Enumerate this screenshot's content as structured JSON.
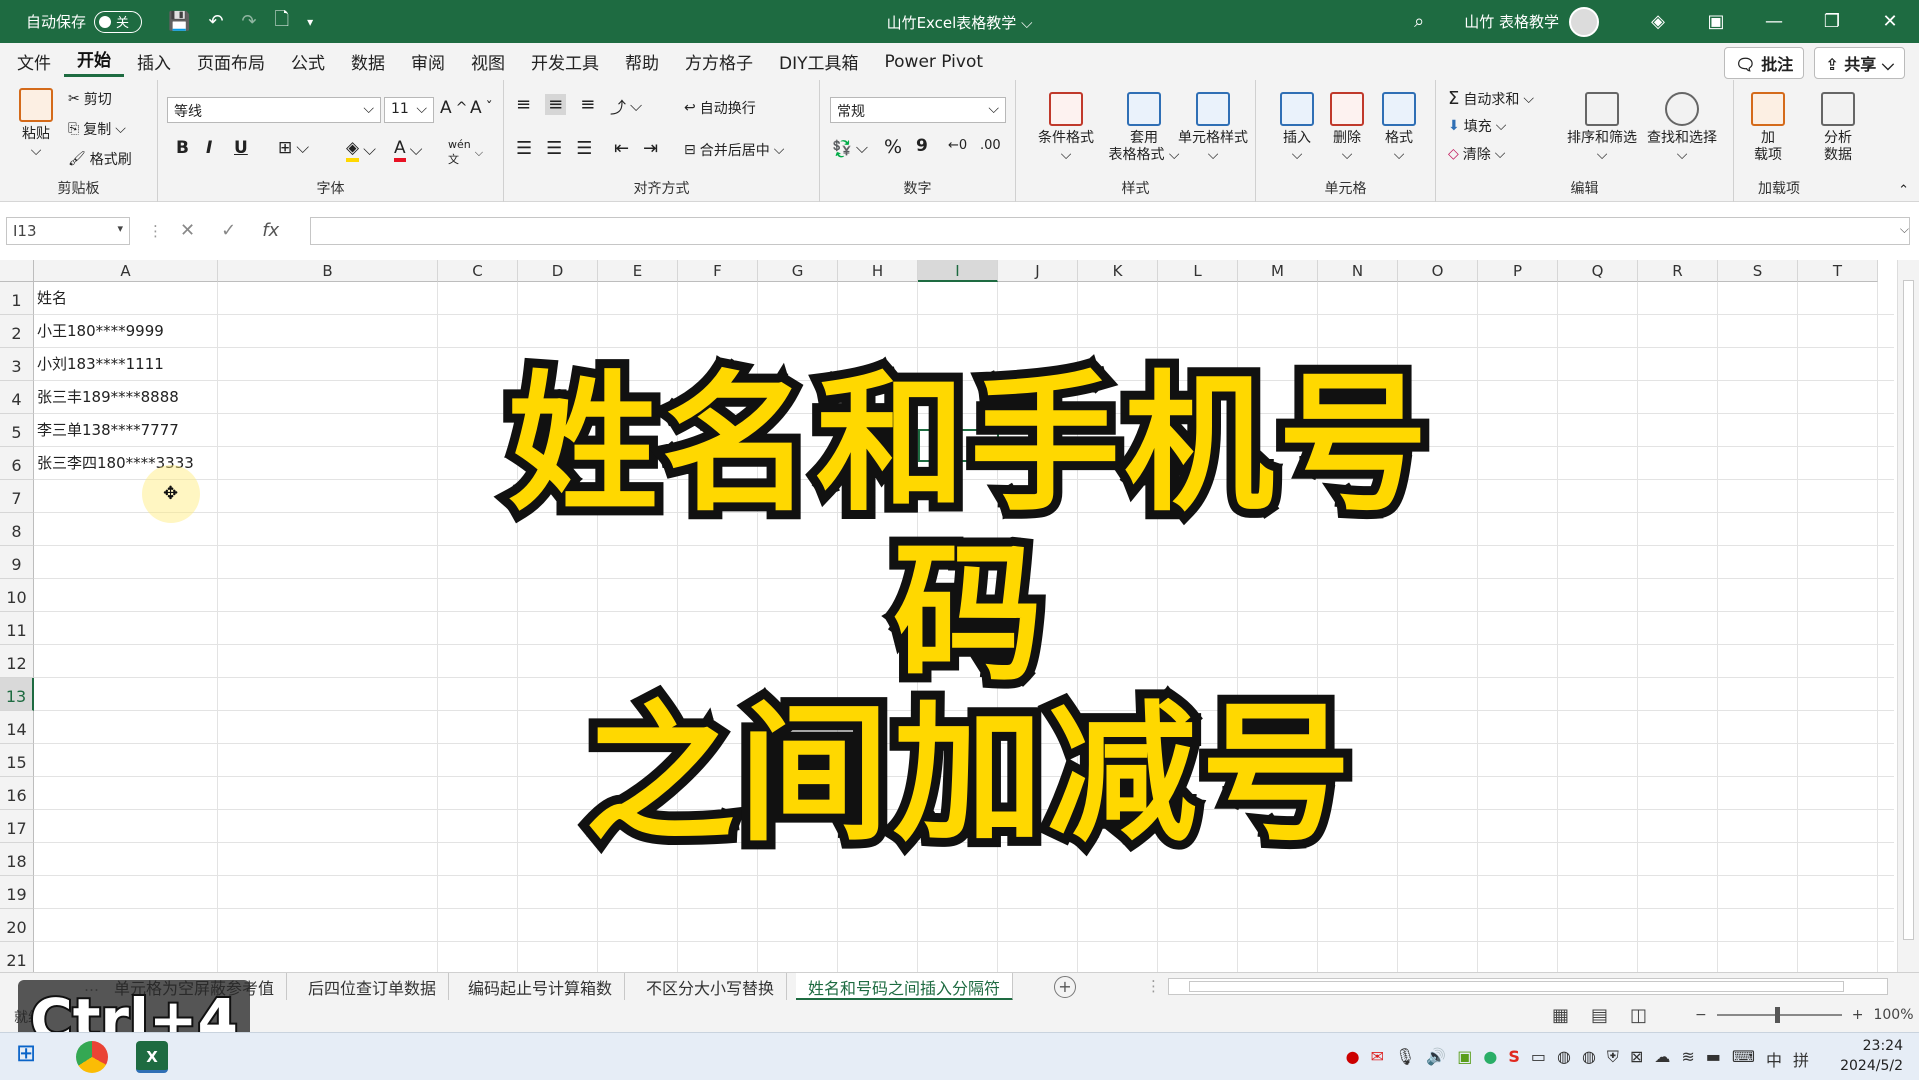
{
  "titlebar": {
    "autosave_label": "自动保存",
    "autosave_state": "关",
    "doc_title": "山竹Excel表格教学 ⌵",
    "user": "山竹 表格教学"
  },
  "menu": {
    "tabs": [
      "文件",
      "开始",
      "插入",
      "页面布局",
      "公式",
      "数据",
      "审阅",
      "视图",
      "开发工具",
      "帮助",
      "方方格子",
      "DIY工具箱",
      "Power Pivot"
    ],
    "comment_btn": "批注",
    "share_btn": "共享"
  },
  "ribbon": {
    "clipboard": {
      "paste": "粘贴",
      "cut": "剪切",
      "copy": "复制",
      "format_painter": "格式刷",
      "label": "剪贴板"
    },
    "font": {
      "name": "等线",
      "size": "11",
      "bold": "B",
      "italic": "I",
      "underline": "U",
      "label": "字体",
      "grow": "A^",
      "shrink": "A˅",
      "phonetic": "wén"
    },
    "alignment": {
      "wrap": "自动换行",
      "merge": "合并后居中",
      "label": "对齐方式"
    },
    "number": {
      "format": "常规",
      "percent": "%",
      "comma": "9",
      "label": "数字"
    },
    "styles": {
      "conditional": "条件格式",
      "table_format": "套用\n表格格式",
      "cell_style": "单元格样式",
      "label": "样式"
    },
    "cells": {
      "insert": "插入",
      "delete": "删除",
      "format": "格式",
      "label": "单元格"
    },
    "editing": {
      "autosum": "自动求和",
      "fill": "填充",
      "clear": "清除",
      "sort": "排序和筛选",
      "find": "查找和选择",
      "label": "编辑"
    },
    "addins": {
      "addin": "加\n载项",
      "analyze": "分析\n数据",
      "label": "加载项"
    }
  },
  "formula_bar": {
    "name_box": "I13",
    "fx": "fx",
    "cancel": "✕",
    "enter": "✓"
  },
  "sheet": {
    "columns": [
      "A",
      "B",
      "C",
      "D",
      "E",
      "F",
      "G",
      "H",
      "I",
      "J",
      "K",
      "L",
      "M",
      "N",
      "O",
      "P",
      "Q",
      "R",
      "S",
      "T"
    ],
    "rows": [
      "1",
      "2",
      "3",
      "4",
      "5",
      "6",
      "7",
      "8",
      "9",
      "10",
      "11",
      "12",
      "13",
      "14",
      "15",
      "16",
      "17",
      "18",
      "19",
      "20",
      "21"
    ],
    "cells_a": [
      "姓名",
      "小王180****9999",
      "小刘183****1111",
      "张三丰189****8888",
      "李三单138****7777",
      "张三李四180****3333"
    ],
    "selected_col": "I",
    "selected_row": "13"
  },
  "overlay": {
    "line1": "姓名和手机号码",
    "line2": "之间加减号"
  },
  "sheet_tabs": [
    "单元格为空屏蔽参考值",
    "后四位查订单数据",
    "编码起止号计算箱数",
    "不区分大小写替换",
    "姓名和号码之间插入分隔符"
  ],
  "status": {
    "ready": "就绪",
    "zoom": "100%",
    "zoom_minus": "−",
    "zoom_plus": "+"
  },
  "keystroke": "Ctrl+4",
  "taskbar": {
    "ime": "中",
    "ime2": "拼",
    "time": "23:24",
    "date": "2024/5/2"
  }
}
